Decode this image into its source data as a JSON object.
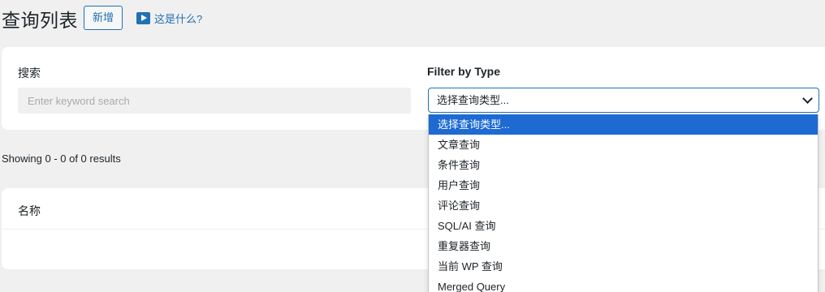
{
  "header": {
    "title": "查询列表",
    "add_new_label": "新增",
    "help_label": "这是什么?"
  },
  "filters": {
    "search_label": "搜索",
    "search_placeholder": "Enter keyword search",
    "type_label": "Filter by Type",
    "type_selected": "选择查询类型..."
  },
  "results": {
    "count_text": "Showing 0 - 0 of 0 results"
  },
  "table": {
    "columns": [
      "名称"
    ]
  },
  "dropdown": {
    "options": [
      "选择查询类型...",
      "文章查询",
      "条件查询",
      "用户查询",
      "评论查询",
      "SQL/AI 查询",
      "重复器查询",
      "当前 WP 查询",
      "Merged Query"
    ],
    "highlighted_index": 0
  },
  "colors": {
    "accent": "#2271b1",
    "highlight": "#1d6ad2",
    "background": "#f0f0f1"
  }
}
